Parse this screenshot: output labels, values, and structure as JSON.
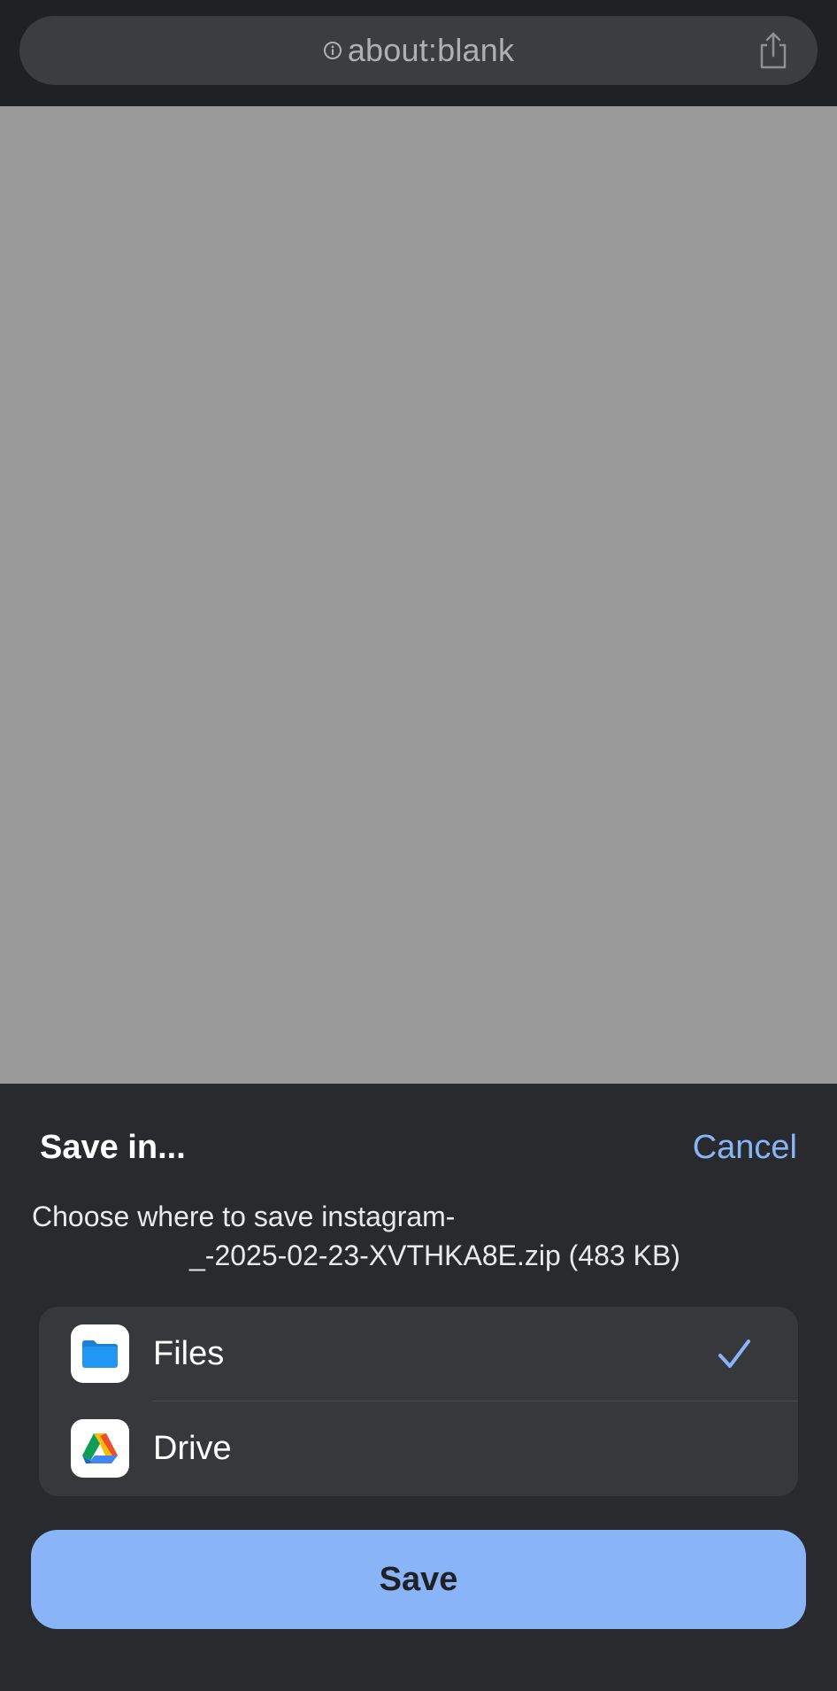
{
  "browser": {
    "url": "about:blank"
  },
  "sheet": {
    "title": "Save in...",
    "cancel_label": "Cancel",
    "description_line1": "Choose where to save instagram-",
    "description_line2": "_-2025-02-23-XVTHKA8E.zip (483 KB)",
    "options": [
      {
        "label": "Files",
        "icon": "files-folder-icon",
        "selected": true
      },
      {
        "label": "Drive",
        "icon": "google-drive-icon",
        "selected": false
      }
    ],
    "save_label": "Save"
  },
  "colors": {
    "accent": "#8ab4f8",
    "sheet_background": "#292a2d",
    "page_background": "#9a9a9a"
  }
}
